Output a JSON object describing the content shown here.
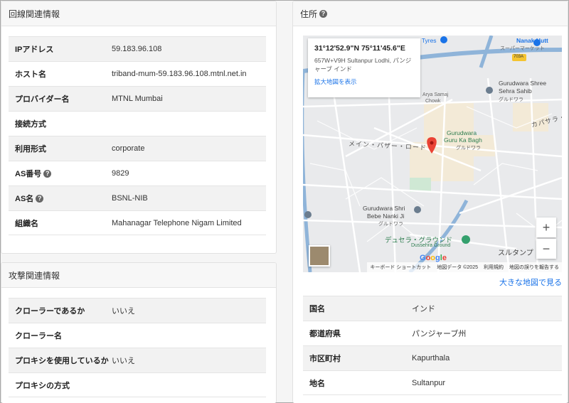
{
  "line_info": {
    "title": "回線関連情報",
    "rows": [
      {
        "key": "IPアドレス",
        "value": "59.183.96.108"
      },
      {
        "key": "ホスト名",
        "value": "triband-mum-59.183.96.108.mtnl.net.in"
      },
      {
        "key": "プロバイダー名",
        "value": "MTNL Mumbai"
      },
      {
        "key": "接続方式",
        "value": ""
      },
      {
        "key": "利用形式",
        "value": "corporate"
      },
      {
        "key": "AS番号",
        "value": "9829"
      },
      {
        "key": "AS名",
        "value": "BSNL-NIB"
      },
      {
        "key": "組織名",
        "value": "Mahanagar Telephone Nigam Limited"
      }
    ]
  },
  "attack_info": {
    "title": "攻撃関連情報",
    "rows": [
      {
        "key": "クローラーであるか",
        "value": "いいえ"
      },
      {
        "key": "クローラー名",
        "value": ""
      },
      {
        "key": "プロキシを使用しているか",
        "value": "いいえ"
      },
      {
        "key": "プロキシの方式",
        "value": ""
      }
    ]
  },
  "address": {
    "title": "住所",
    "map": {
      "coords": "31°12'52.9\"N 75°11'45.6\"E",
      "place_line1": "657W+V9H Sultanpur Lodhi, パンジ",
      "place_line2": "ャーブ インド",
      "enlarge_link": "拡大地図を表示",
      "zoom_in": "+",
      "zoom_out": "−",
      "google": "Google",
      "footer": {
        "shortcuts": "キーボード ショートカット",
        "map_data": "地図データ ©2025",
        "terms": "利用規約",
        "report": "地図の誤りを報告する"
      },
      "labels": {
        "pritam": "Pritam Tyres",
        "nanak": "Nanak Hutt",
        "supermarket": "スーパーマーケット",
        "shield": "703A",
        "gurudwara_shree1": "Gurudwara Shree",
        "gurudwara_shree2": "Sehra Sahib",
        "gurudwara_jp": "グルドワラ",
        "arya1": "Arya Samaj",
        "arya2": "Chowk",
        "kabusara": "カパサラ・ロ",
        "gurudwara_guru1": "Gurudwara",
        "gurudwara_guru2": "Guru Ka Bagh",
        "gurudwara_guru_jp": "グルドワラ",
        "main_bazaar": "メイン・バザー・ロード",
        "bebe1": "Gurudwara Shri",
        "bebe2": "Bebe Nanki Ji",
        "bebe_jp": "グルドワラ",
        "dussehra_jp": "デュセラ・グラウンド",
        "dussehra": "Dussehra Ground",
        "sultanpur": "スルタンプ"
      }
    },
    "big_map_link": "大きな地図で見る",
    "rows": [
      {
        "key": "国名",
        "value": "インド"
      },
      {
        "key": "都道府県",
        "value": "パンジャーブ州"
      },
      {
        "key": "市区町村",
        "value": "Kapurthala"
      },
      {
        "key": "地名",
        "value": "Sultanpur"
      }
    ]
  },
  "colors": {
    "link": "#1a73e8",
    "marker": "#ea4335",
    "road_blue": "#8fb4d9",
    "poi_green": "#34a06d"
  }
}
